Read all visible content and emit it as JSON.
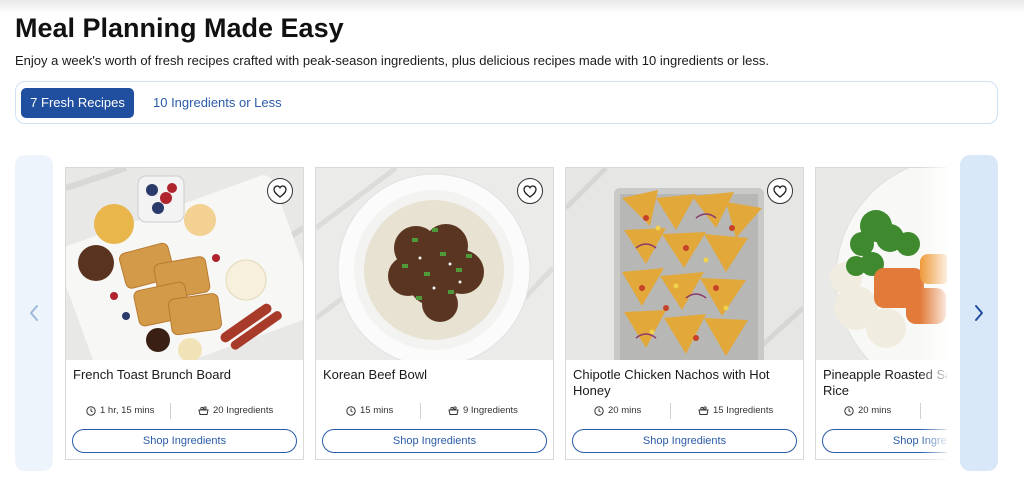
{
  "header": {
    "title": "Meal Planning Made Easy",
    "subtitle": "Enjoy a week's worth of fresh recipes crafted with peak-season ingredients, plus delicious recipes made with 10 ingredients or less."
  },
  "tabs": [
    {
      "label": "7 Fresh Recipes",
      "active": true
    },
    {
      "label": "10 Ingredients or Less",
      "active": false
    }
  ],
  "carousel": {
    "prev_icon": "chevron-left-icon",
    "next_icon": "chevron-right-icon"
  },
  "recipes": [
    {
      "title": "French Toast Brunch Board",
      "time": "1 hr, 15 mins",
      "ingredients": "20 Ingredients",
      "button": "Shop Ingredients"
    },
    {
      "title": "Korean Beef Bowl",
      "time": "15 mins",
      "ingredients": "9 Ingredients",
      "button": "Shop Ingredients"
    },
    {
      "title": "Chipotle Chicken Nachos with Hot Honey",
      "time": "20 mins",
      "ingredients": "15 Ingredients",
      "button": "Shop Ingredients"
    },
    {
      "title": "Pineapple Roasted Salmon with Citrus Rice",
      "time": "20 mins",
      "ingredients": "",
      "button": "Shop Ingredients"
    }
  ],
  "colors": {
    "accent": "#1f4f9e",
    "link": "#2a5ba8",
    "tab_border": "#cfe2f5"
  }
}
